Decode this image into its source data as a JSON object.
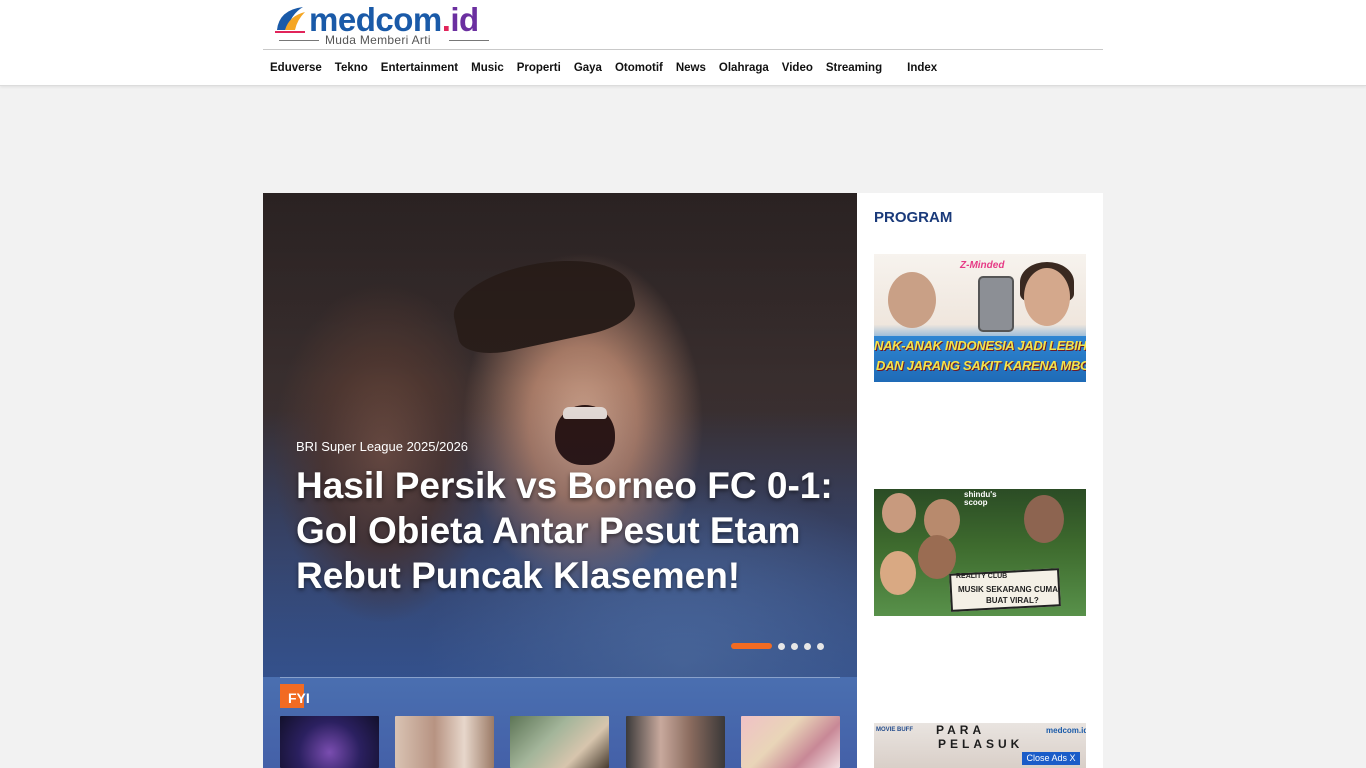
{
  "header": {
    "logo": {
      "brand": "medcom",
      "dot": ".",
      "tld": "id",
      "tagline": "Muda Memberi Arti"
    },
    "nav": [
      {
        "label": "Eduverse"
      },
      {
        "label": "Tekno"
      },
      {
        "label": "Entertainment"
      },
      {
        "label": "Music"
      },
      {
        "label": "Properti"
      },
      {
        "label": "Gaya"
      },
      {
        "label": "Otomotif"
      },
      {
        "label": "News"
      },
      {
        "label": "Olahraga"
      },
      {
        "label": "Video"
      },
      {
        "label": "Streaming"
      },
      {
        "label": "Index"
      }
    ]
  },
  "hero": {
    "kicker": "BRI Super League 2025/2026",
    "title": "Hasil Persik vs Borneo FC 0-1: Gol Obieta Antar Pesut Etam Rebut Puncak Klasemen!",
    "slides_total": 5,
    "active_slide": 1
  },
  "fyi": {
    "label": "FYI",
    "thumbnails": 5
  },
  "sidebar": {
    "title": "PROGRAM",
    "programs": [
      {
        "badge": "Z-Minded",
        "caption_line1": "NAK-ANAK INDONESIA JADI LEBIH AKTI",
        "caption_line2": "DAN JARANG SAKIT KARENA MBG"
      },
      {
        "brand_line1": "shindu's",
        "brand_line2": "scoop",
        "caption_line1": "REALITY CLUB",
        "caption_line2": "MUSIK SEKARANG CUMA",
        "caption_line3": "BUAT VIRAL?"
      },
      {
        "brand_left": "MOVIE BUFF",
        "title_line1": "PARA",
        "title_line2": "PELASUK",
        "brand_right": "medcom.id"
      }
    ]
  },
  "ads": {
    "close_label": "Close Ads X"
  },
  "colors": {
    "accent_orange": "#f26b22",
    "program_title": "#1a3a7a",
    "logo_blue": "#1a5aa8",
    "close_ads_blue": "#1a5cc8"
  }
}
